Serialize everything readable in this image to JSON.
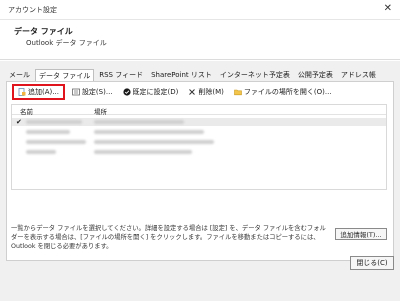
{
  "window": {
    "title": "アカウント設定",
    "close_glyph": "✕"
  },
  "header": {
    "title": "データ ファイル",
    "subtitle": "Outlook データ ファイル"
  },
  "tabs": [
    {
      "label": "メール"
    },
    {
      "label": "データ ファイル"
    },
    {
      "label": "RSS フィード"
    },
    {
      "label": "SharePoint リスト"
    },
    {
      "label": "インターネット予定表"
    },
    {
      "label": "公開予定表"
    },
    {
      "label": "アドレス帳"
    }
  ],
  "toolbar": {
    "add": "追加(A)...",
    "settings": "設定(S)...",
    "set_default": "既定に設定(D)",
    "delete": "削除(M)",
    "open_location": "ファイルの場所を開く(O)..."
  },
  "list": {
    "columns": {
      "name": "名前",
      "location": "場所"
    },
    "default_mark": "✔"
  },
  "help_text": "一覧からデータ ファイルを選択してください。詳細を設定する場合は [設定] を、データ ファイルを含むフォルダーを表示する場合は、[ファイルの場所を開く] をクリックします。ファイルを移動またはコピーするには、Outlook を閉じる必要があります。",
  "buttons": {
    "extra_info": "追加情報(T)...",
    "close": "閉じる(C)"
  },
  "colors": {
    "highlight_red": "#e0141d",
    "panel_bg": "#f0f0f0"
  }
}
